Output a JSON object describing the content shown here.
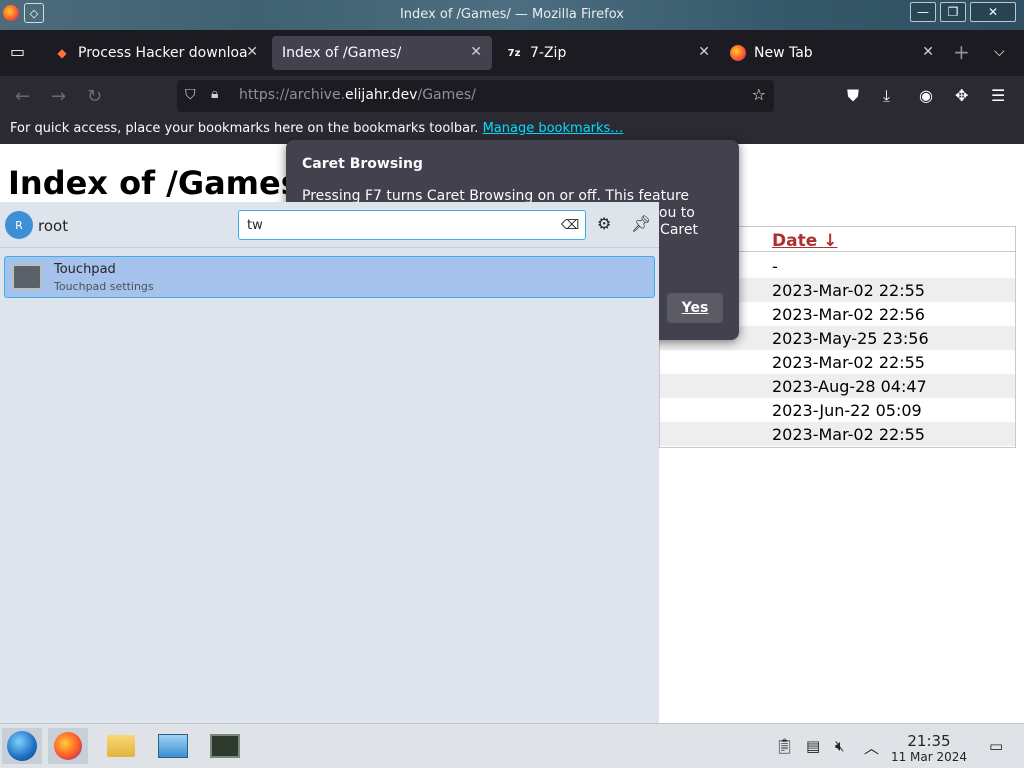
{
  "window": {
    "title": "Index of /Games/ — Mozilla Firefox",
    "minimize_icon": "—",
    "maximize_icon": "❐",
    "close_icon": "✕"
  },
  "tabs": [
    {
      "label": "Process Hacker downloa",
      "icon": "process-hacker-icon",
      "active": false
    },
    {
      "label": "Index of /Games/",
      "icon": "",
      "active": true
    },
    {
      "label": "7-Zip",
      "icon": "7zip-icon",
      "active": false
    },
    {
      "label": "New Tab",
      "icon": "firefox-icon",
      "active": false
    }
  ],
  "urlbar": {
    "url_prefix": "https://archive.",
    "url_host": "elijahr.dev",
    "url_path": "/Games/"
  },
  "bookmarks_bar": {
    "text": "For quick access, place your bookmarks here on the bookmarks toolbar.",
    "link": "Manage bookmarks…"
  },
  "page": {
    "heading": "Index of /Games/",
    "date_header": "Date",
    "sort_indicator": "↓",
    "dates": [
      "-",
      "2023-Mar-02 22:55",
      "2023-Mar-02 22:56",
      "2023-May-25 23:56",
      "2023-Mar-02 22:55",
      "2023-Aug-28 04:47",
      "2023-Jun-22 05:09",
      "2023-Mar-02 22:55"
    ]
  },
  "caret_dialog": {
    "title": "Caret Browsing",
    "body": "Pressing F7 turns Caret Browsing on or off. This feature places a moveable cursor in web pages, allowing you to select text with the keyboard. Do you want to turn Caret Browsing on?",
    "yes_label": "Yes"
  },
  "launcher": {
    "avatar_letter": "R",
    "username": "root",
    "search_value": "tw",
    "results": [
      {
        "title": "Touchpad",
        "subtitle": "Touchpad settings"
      }
    ]
  },
  "taskbar": {
    "time": "21:35",
    "date": "11 Mar 2024"
  },
  "colors": {
    "accent": "#3daee9",
    "selection": "#a5c2ec",
    "link": "#00ddff"
  }
}
